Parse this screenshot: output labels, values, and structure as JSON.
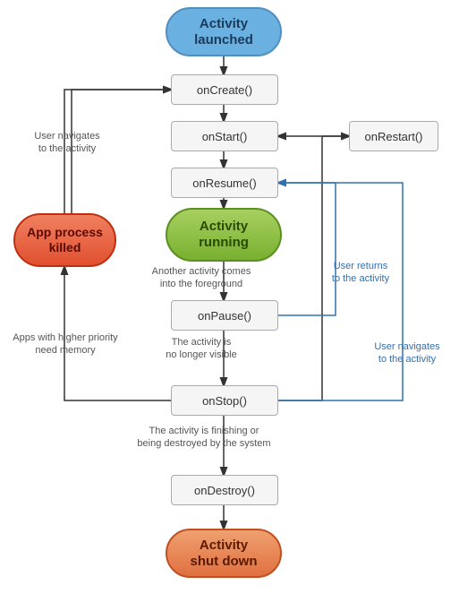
{
  "nodes": {
    "activity_launched": "Activity\nlaunched",
    "on_create": "onCreate()",
    "on_start": "onStart()",
    "on_resume": "onResume()",
    "activity_running": "Activity\nrunning",
    "on_pause": "onPause()",
    "on_stop": "onStop()",
    "on_destroy": "onDestroy()",
    "activity_shutdown": "Activity\nshut down",
    "app_process_killed": "App process\nkilled",
    "on_restart": "onRestart()"
  },
  "labels": {
    "user_navigates_to_activity_top": "User navigates\nto the activity",
    "another_activity_foreground": "Another activity comes\ninto the foreground",
    "apps_higher_priority": "Apps with higher priority\nneed memory",
    "activity_no_longer_visible": "The activity is\nno longer visible",
    "activity_finishing": "The activity is finishing or\nbeing destroyed by the system",
    "user_returns": "User returns\nto the activity",
    "user_navigates_to_activity_bottom": "User navigates\nto the activity"
  }
}
